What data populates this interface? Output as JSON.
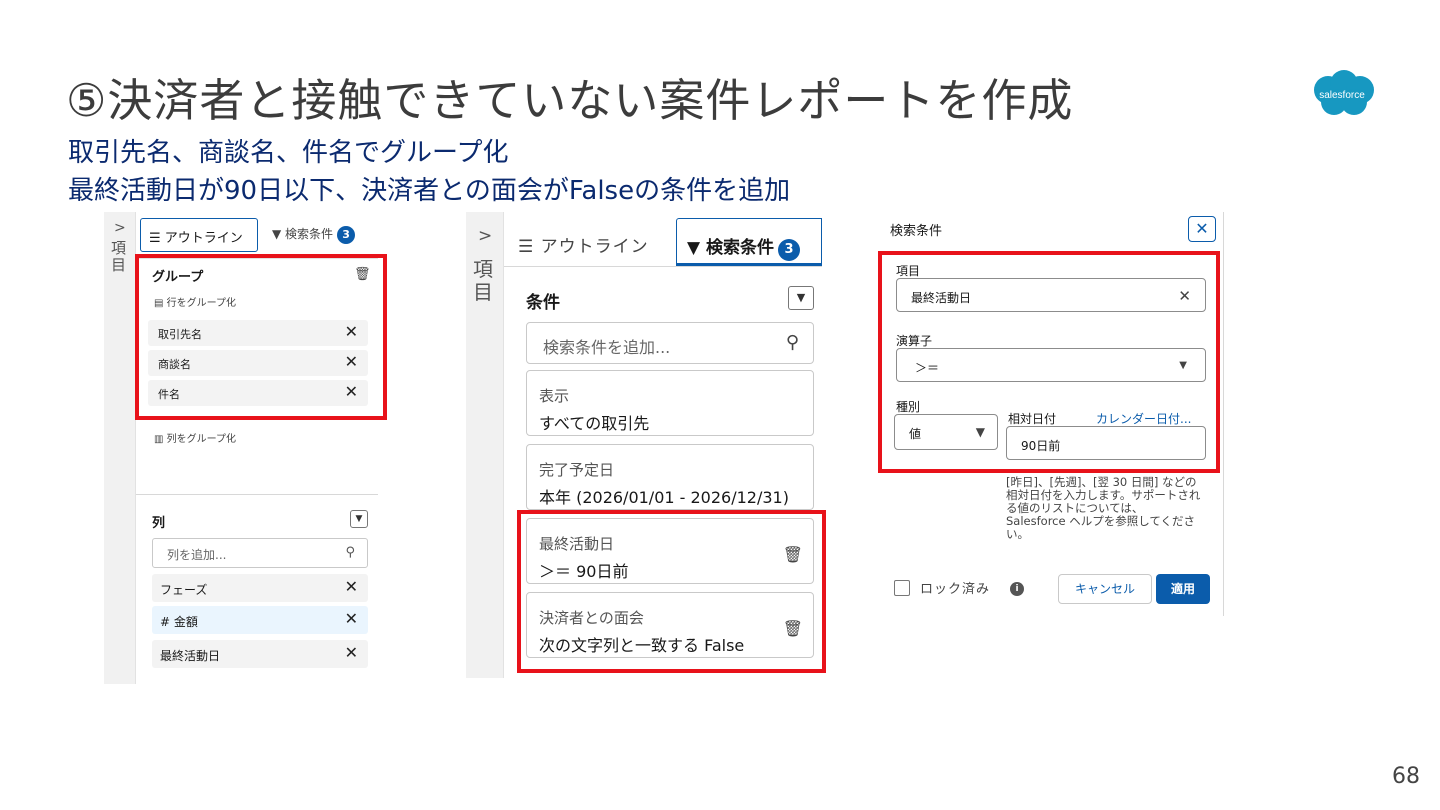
{
  "slide": {
    "title": "⑤決済者と接触できていない案件レポートを作成",
    "subtitle_1": "取引先名、商談名、件名でグループ化",
    "subtitle_2": "最終活動日が90日以下、決済者との面会がFalseの条件を追加",
    "logo_text": "salesforce",
    "page_number": "68",
    "accent_color": "#0b5cab",
    "highlight_color": "#e8121a"
  },
  "panel1": {
    "rail_label": "項目",
    "tab_outline": "☰ アウトライン",
    "tab_filter": "▼ 検索条件",
    "tab_filter_count": "3",
    "group_heading": "グループ",
    "row_group_label": "行をグループ化",
    "group_chips": [
      "取引先名",
      "商談名",
      "件名"
    ],
    "column_group_label": "列をグループ化",
    "columns_heading": "列",
    "column_search_placeholder": "列を追加...",
    "column_chips": [
      "フェーズ",
      "# 金額",
      "最終活動日"
    ]
  },
  "panel2": {
    "rail_label": "項目",
    "tab_outline": "☰ アウトライン",
    "tab_filter": "▼ 検索条件",
    "tab_filter_count": "3",
    "heading": "条件",
    "search_placeholder": "検索条件を追加...",
    "cards": [
      {
        "label": "表示",
        "value": "すべての取引先"
      },
      {
        "label": "完了予定日",
        "value": "本年 (2026/01/01 - 2026/12/31)"
      },
      {
        "label": "最終活動日",
        "value": "＞＝ 90日前"
      },
      {
        "label": "決済者との面会",
        "value": "次の文字列と一致する False"
      }
    ]
  },
  "panel3": {
    "title": "検索条件",
    "field_label": "項目",
    "field_value": "最終活動日",
    "operator_label": "演算子",
    "operator_value": "＞＝",
    "type_label": "種別",
    "type_value": "値",
    "relative_date_label": "相対日付",
    "calendar_link": "カレンダー日付...",
    "date_value": "90日前",
    "help_text": "[昨日]、[先週]、[翌 30 日間] などの相対日付を入力します。サポートされる値のリストについては、Salesforce ヘルプを参照してください。",
    "lock_label": "ロック済み",
    "cancel_label": "キャンセル",
    "apply_label": "適用"
  }
}
